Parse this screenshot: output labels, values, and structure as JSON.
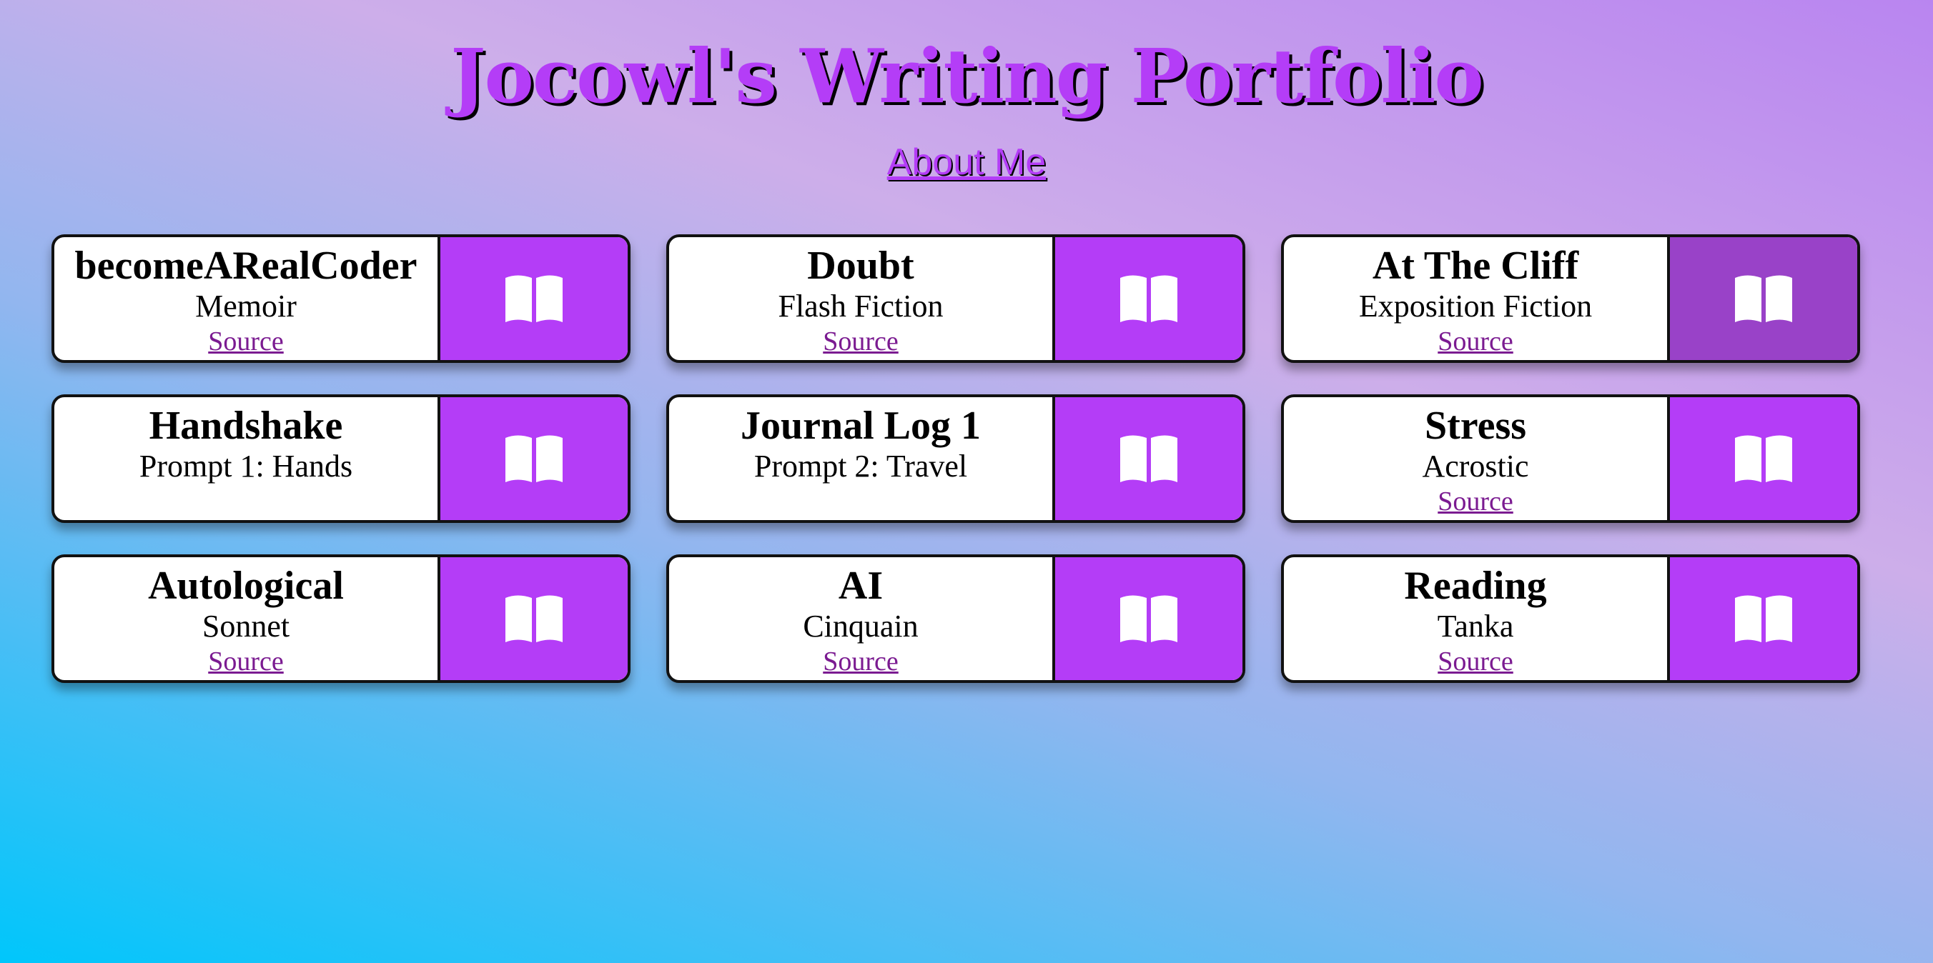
{
  "header": {
    "title": "Jocowl's Writing Portfolio",
    "about_link": "About Me"
  },
  "colors": {
    "accent": "#b43df7",
    "accent_hover": "#9942c8",
    "source_link": "#7b1b91"
  },
  "cards": [
    {
      "title": "becomeARealCoder",
      "genre": "Memoir",
      "source": "Source",
      "icon": "open-book-icon",
      "hovered": false
    },
    {
      "title": "Doubt",
      "genre": "Flash Fiction",
      "source": "Source",
      "icon": "open-book-icon",
      "hovered": false
    },
    {
      "title": "At The Cliff",
      "genre": "Exposition Fiction",
      "source": "Source",
      "icon": "open-book-icon",
      "hovered": true
    },
    {
      "title": "Handshake",
      "genre": "Prompt 1: Hands",
      "source": "",
      "icon": "open-book-icon",
      "hovered": false
    },
    {
      "title": "Journal Log 1",
      "genre": "Prompt 2: Travel",
      "source": "",
      "icon": "open-book-icon",
      "hovered": false
    },
    {
      "title": "Stress",
      "genre": "Acrostic",
      "source": "Source",
      "icon": "open-book-icon",
      "hovered": false
    },
    {
      "title": "Autological",
      "genre": "Sonnet",
      "source": "Source",
      "icon": "open-book-icon",
      "hovered": false
    },
    {
      "title": "AI",
      "genre": "Cinquain",
      "source": "Source",
      "icon": "open-book-icon",
      "hovered": false
    },
    {
      "title": "Reading",
      "genre": "Tanka",
      "source": "Source",
      "icon": "open-book-icon",
      "hovered": false
    }
  ]
}
